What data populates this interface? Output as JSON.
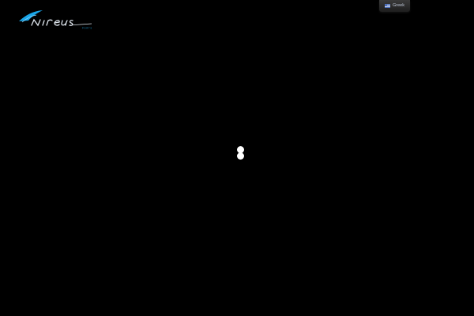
{
  "header": {
    "logo": {
      "wordmark": "nireus",
      "tagline": "PORTS",
      "accent_color": "#1aa6e8",
      "text_color": "#dfe6ee"
    },
    "language_switch": {
      "flag_icon": "greek-flag-icon",
      "label": "Greek"
    }
  },
  "main": {
    "loader": {
      "icon": "loading-spinner-icon",
      "color": "#ffffff"
    }
  },
  "theme": {
    "background": "#000000"
  }
}
